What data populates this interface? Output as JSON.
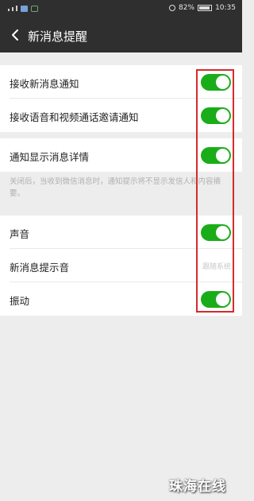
{
  "status_bar": {
    "battery": "82%",
    "time": "10:35"
  },
  "header": {
    "title": "新消息提醒"
  },
  "sections": [
    {
      "rows": [
        {
          "label": "接收新消息通知",
          "toggle": "on"
        },
        {
          "label": "接收语音和视频通话邀请通知",
          "toggle": "on"
        }
      ]
    },
    {
      "rows": [
        {
          "label": "通知显示消息详情",
          "toggle": "on"
        }
      ],
      "note": "关闭后，当收到微信消息时，通知提示将不显示发信人和内容摘要。"
    },
    {
      "rows": [
        {
          "label": "声音",
          "toggle": "on"
        },
        {
          "label": "新消息提示音",
          "value": "跟随系统"
        },
        {
          "label": "振动",
          "toggle": "on"
        }
      ]
    }
  ],
  "colors": {
    "toggle_on": "#1aad19",
    "header_bg": "#2f2f2f",
    "highlight": "#d62a2a"
  },
  "watermark": "珠海在线"
}
